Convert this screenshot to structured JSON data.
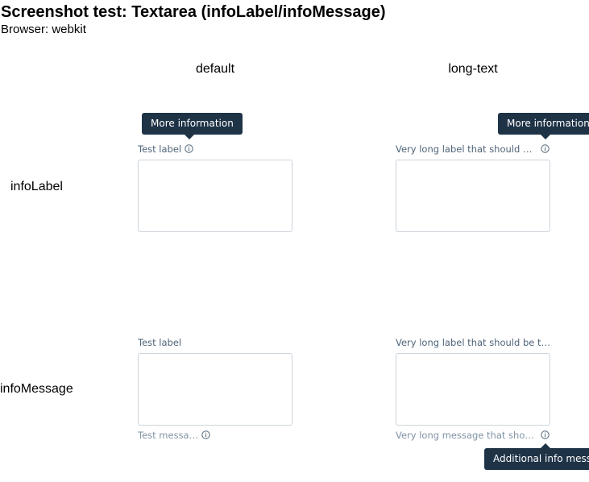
{
  "page": {
    "title": "Screenshot test: Textarea (infoLabel/infoMessage)",
    "browser": "Browser: webkit"
  },
  "columns": [
    "default",
    "long-text"
  ],
  "rows": [
    "infoLabel",
    "infoMessage"
  ],
  "cells": {
    "info_label_default": {
      "label": "Test label",
      "tooltip": "More information",
      "value": ""
    },
    "info_label_long": {
      "label": "Very long label that should be truncated",
      "tooltip": "More information",
      "value": ""
    },
    "info_message_default": {
      "label": "Test label",
      "message": "Test message",
      "value": ""
    },
    "info_message_long": {
      "label": "Very long label that should be truncated",
      "message": "Very long message that should be truncated",
      "tooltip": "Additional info message",
      "value": ""
    }
  },
  "colors": {
    "tooltip_bg": "#1f3347",
    "label_text": "#4f6478",
    "message_text": "#8193a5",
    "border": "#cdd4db"
  },
  "icons": {
    "info": "info-circle-icon"
  }
}
